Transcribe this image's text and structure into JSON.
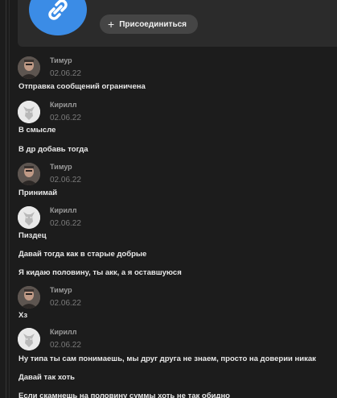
{
  "invite": {
    "join_label": "Присоединиться",
    "accent_color": "#3b8ce6"
  },
  "authors": {
    "timur": "Тимур",
    "kirill": "Кирилл"
  },
  "messages": [
    {
      "author": "Тимур",
      "date": "02.06.22",
      "lines": [
        "Отправка сообщений ограничена"
      ]
    },
    {
      "author": "Кирилл",
      "date": "02.06.22",
      "lines": [
        "В смысле",
        "В др добавь тогда"
      ]
    },
    {
      "author": "Тимур",
      "date": "02.06.22",
      "lines": [
        "Принимай"
      ]
    },
    {
      "author": "Кирилл",
      "date": "02.06.22",
      "lines": [
        "Пиздец",
        "Давай тогда как в старые добрые",
        "Я кидаю половину, ты акк, а я оставшуюся"
      ]
    },
    {
      "author": "Тимур",
      "date": "02.06.22",
      "lines": [
        "Хз"
      ]
    },
    {
      "author": "Кирилл",
      "date": "02.06.22",
      "lines": [
        "Ну типа ты сам понимаешь, мы друг друга не знаем, просто на доверии никак",
        "Давай так хоть",
        "Если скамнешь на половину суммы хоть не так обидно"
      ]
    }
  ]
}
